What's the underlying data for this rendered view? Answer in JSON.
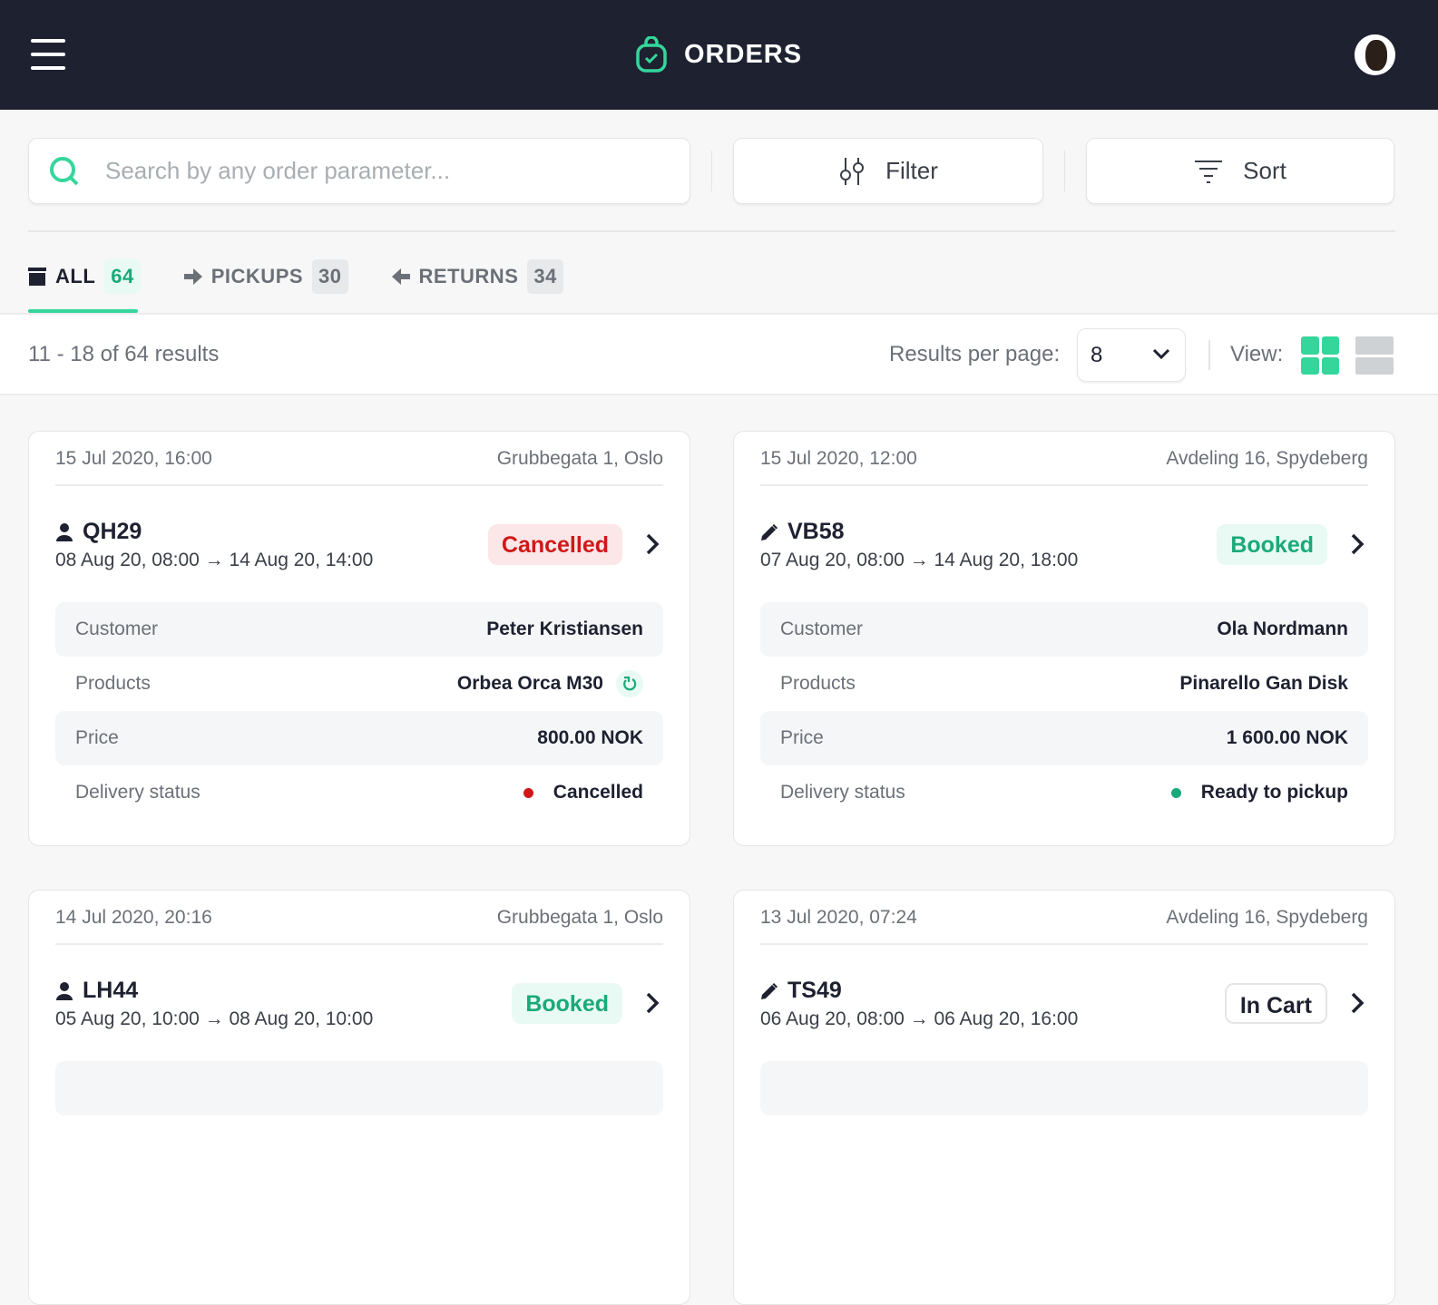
{
  "header": {
    "title": "ORDERS"
  },
  "search": {
    "placeholder": "Search by any order parameter..."
  },
  "toolbar": {
    "filter_label": "Filter",
    "sort_label": "Sort"
  },
  "tabs": [
    {
      "label": "ALL",
      "count": "64"
    },
    {
      "label": "PICKUPS",
      "count": "30"
    },
    {
      "label": "RETURNS",
      "count": "34"
    }
  ],
  "results": {
    "summary": "11 - 18 of 64 results",
    "per_page_label": "Results per page:",
    "per_page_value": "8",
    "view_label": "View:"
  },
  "labels": {
    "customer": "Customer",
    "products": "Products",
    "price": "Price",
    "delivery": "Delivery status"
  },
  "orders": [
    {
      "date": "15 Jul 2020, 16:00",
      "location": "Grubbegata 1, Oslo",
      "id": "QH29",
      "range": "08 Aug 20, 08:00 → 14 Aug 20, 14:00",
      "status": "Cancelled",
      "customer": "Peter Kristiansen",
      "product": "Orbea Orca M30",
      "price": "800.00 NOK",
      "delivery": "Cancelled",
      "delivery_color": "#d01818"
    },
    {
      "date": "15 Jul 2020, 12:00",
      "location": "Avdeling 16, Spydeberg",
      "id": "VB58",
      "range": "07 Aug 20, 08:00 → 14 Aug 20, 18:00",
      "status": "Booked",
      "customer": "Ola Nordmann",
      "product": "Pinarello Gan Disk",
      "price": "1 600.00 NOK",
      "delivery": "Ready to pickup",
      "delivery_color": "#1ba97a"
    },
    {
      "date": "14 Jul 2020, 20:16",
      "location": "Grubbegata 1, Oslo",
      "id": "LH44",
      "range": "05 Aug 20, 10:00 → 08 Aug 20, 10:00",
      "status": "Booked"
    },
    {
      "date": "13 Jul 2020, 07:24",
      "location": "Avdeling 16, Spydeberg",
      "id": "TS49",
      "range": "06 Aug 20, 08:00 → 06 Aug 20, 16:00",
      "status": "In Cart"
    }
  ]
}
